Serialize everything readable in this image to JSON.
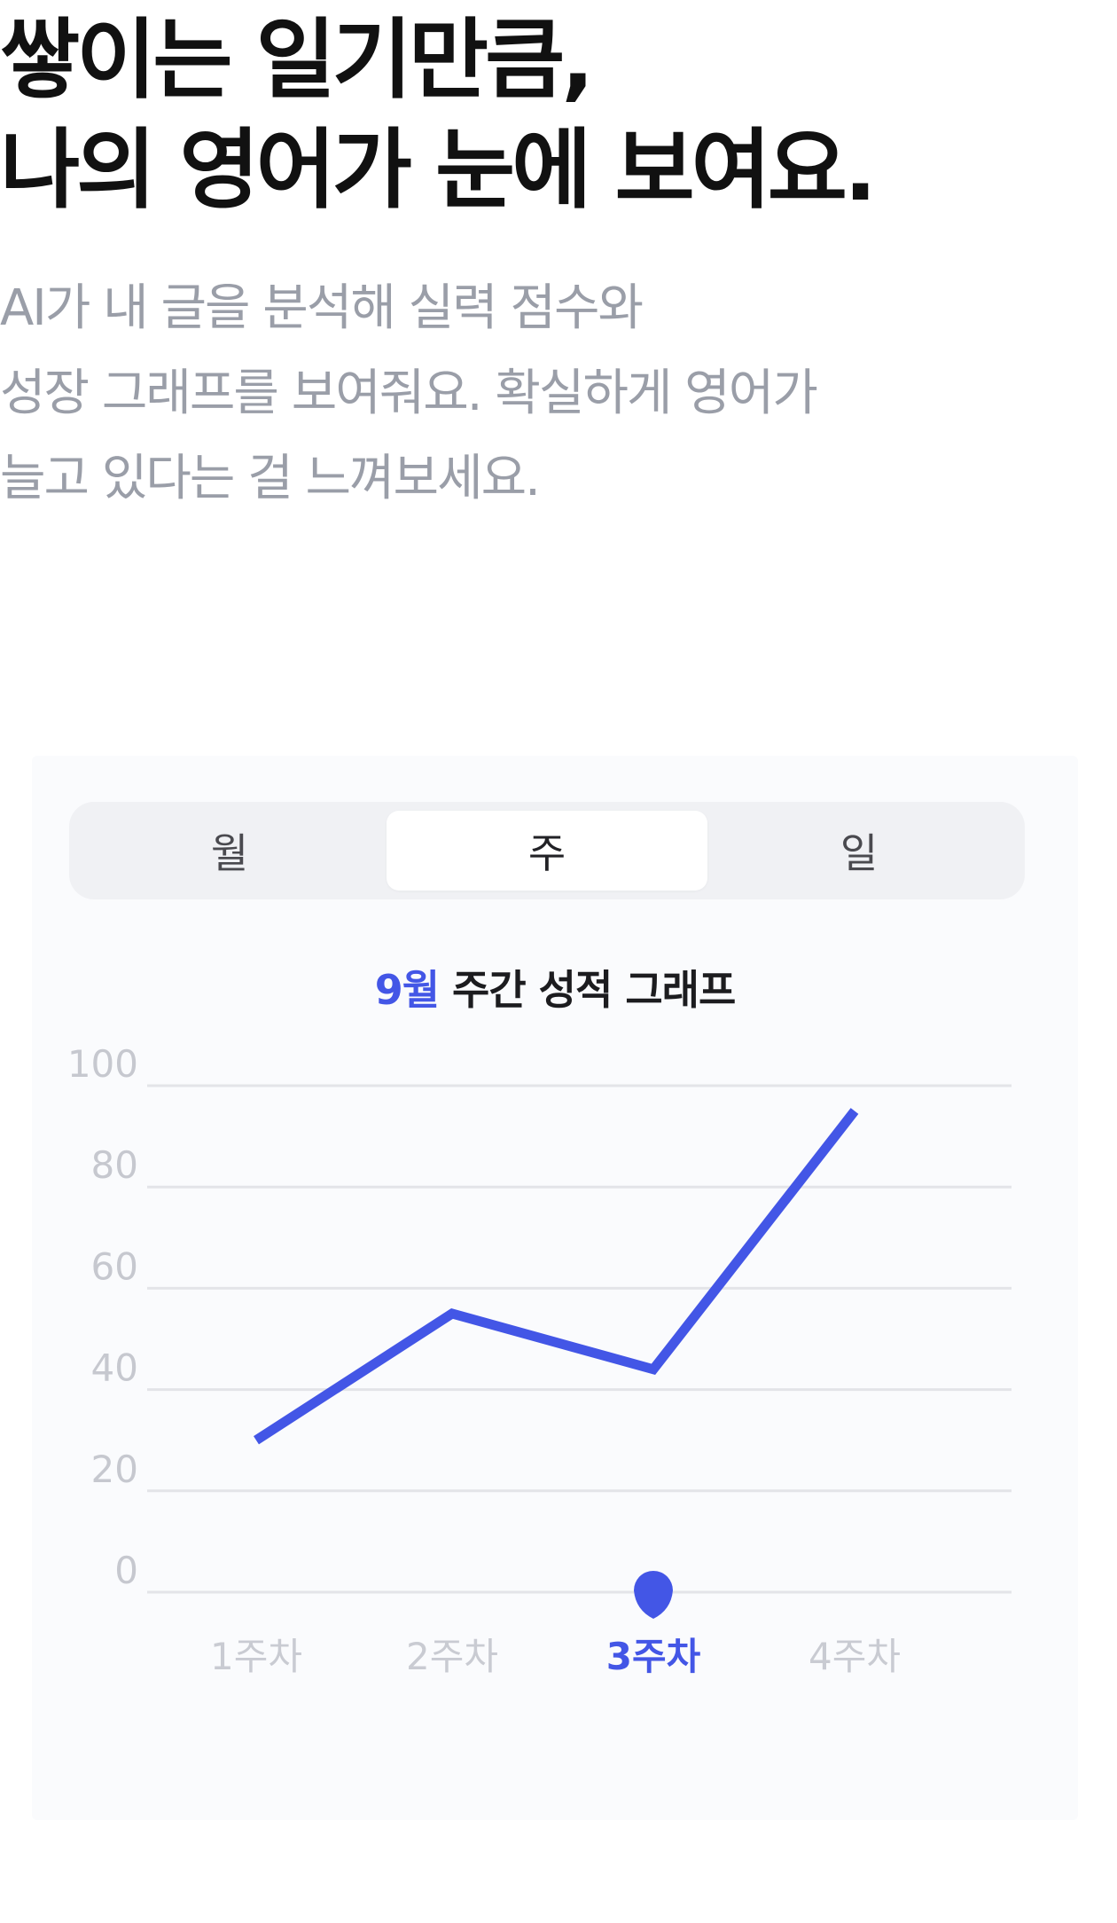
{
  "hero": {
    "title_line1": "쌓이는 일기만큼,",
    "title_line2": "나의 영어가 눈에 보여요.",
    "desc_line1": "AI가 내 글을 분석해 실력 점수와",
    "desc_line2": "성장 그래프를 보여줘요. 확실하게 영어가",
    "desc_line3": "늘고 있다는 걸 느껴보세요."
  },
  "period_tabs": [
    {
      "label": "월",
      "selected": false
    },
    {
      "label": "주",
      "selected": true
    },
    {
      "label": "일",
      "selected": false
    }
  ],
  "chart_data": {
    "type": "line",
    "title_month": "9월",
    "title_rest": " 주간 성적 그래프",
    "categories": [
      "1주차",
      "2주차",
      "3주차",
      "4주차"
    ],
    "values": [
      30,
      55,
      44,
      95
    ],
    "selected_category": "3주차",
    "yticks": [
      "100",
      "80",
      "60",
      "40",
      "20",
      "0"
    ],
    "ylim": [
      0,
      100
    ],
    "grid": true,
    "line_color": "#4356e6"
  }
}
